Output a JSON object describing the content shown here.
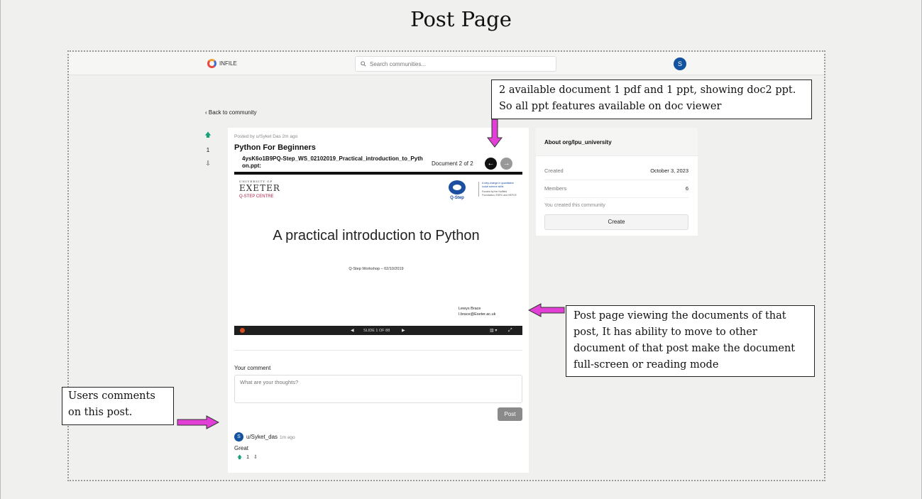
{
  "page_title": "Post Page",
  "navbar": {
    "logo_text": "INFILE",
    "search_placeholder": "Search communities...",
    "avatar_initial": "S"
  },
  "back_link": "Back to community",
  "post": {
    "votes": {
      "count": "1"
    },
    "posted_by": "Posted by u/Syket Das 2m ago",
    "title": "Python For Beginners",
    "filename": "4ysK6o1B9PQ-Step_WS_02102019_Practical_introduction_to_Python.ppt:",
    "doc_counter": "Document 2 of 2",
    "slide": {
      "uni_small": "UNIVERSITY OF",
      "uni_name": "EXETER",
      "uni_centre": "Q-STEP CENTRE",
      "q_label": "Q-Step",
      "tagline": "A step-change in quantitative social science skills",
      "funded": "Funded by the Nuffield Foundation, ESRC and HEFCE",
      "heading": "A practical introduction to Python",
      "subheading": "Q-Step Workshop – 02/10/2019",
      "author_name": "Lewys Brace",
      "author_email": "l.brace@Exeter.ac.uk"
    },
    "viewer_bar": {
      "slide_label": "SLIDE 1 OF 88"
    }
  },
  "comment_form": {
    "label": "Your comment",
    "placeholder": "What are your thoughts?",
    "submit": "Post"
  },
  "comments": [
    {
      "avatar": "S",
      "user": "u/Syket_das",
      "time": "1m ago",
      "text": "Great",
      "votes": "1"
    }
  ],
  "about": {
    "title": "About org/lpu_university",
    "created_label": "Created",
    "created_value": "October 3, 2023",
    "members_label": "Members",
    "members_value": "6",
    "created_note": "You created this community",
    "create_button": "Create"
  },
  "annotations": {
    "docs": [
      "2 available document 1 pdf and 1 ppt, showing doc2 ppt.",
      "So all ppt features available on doc viewer"
    ],
    "viewer": [
      "Post page viewing the documents of that",
      "post, It has ability to move to other",
      "document of that post make the document",
      "full-screen or reading mode"
    ],
    "comments": [
      "Users comments",
      "on this post."
    ],
    "arrow_color": "#e23fd6"
  }
}
